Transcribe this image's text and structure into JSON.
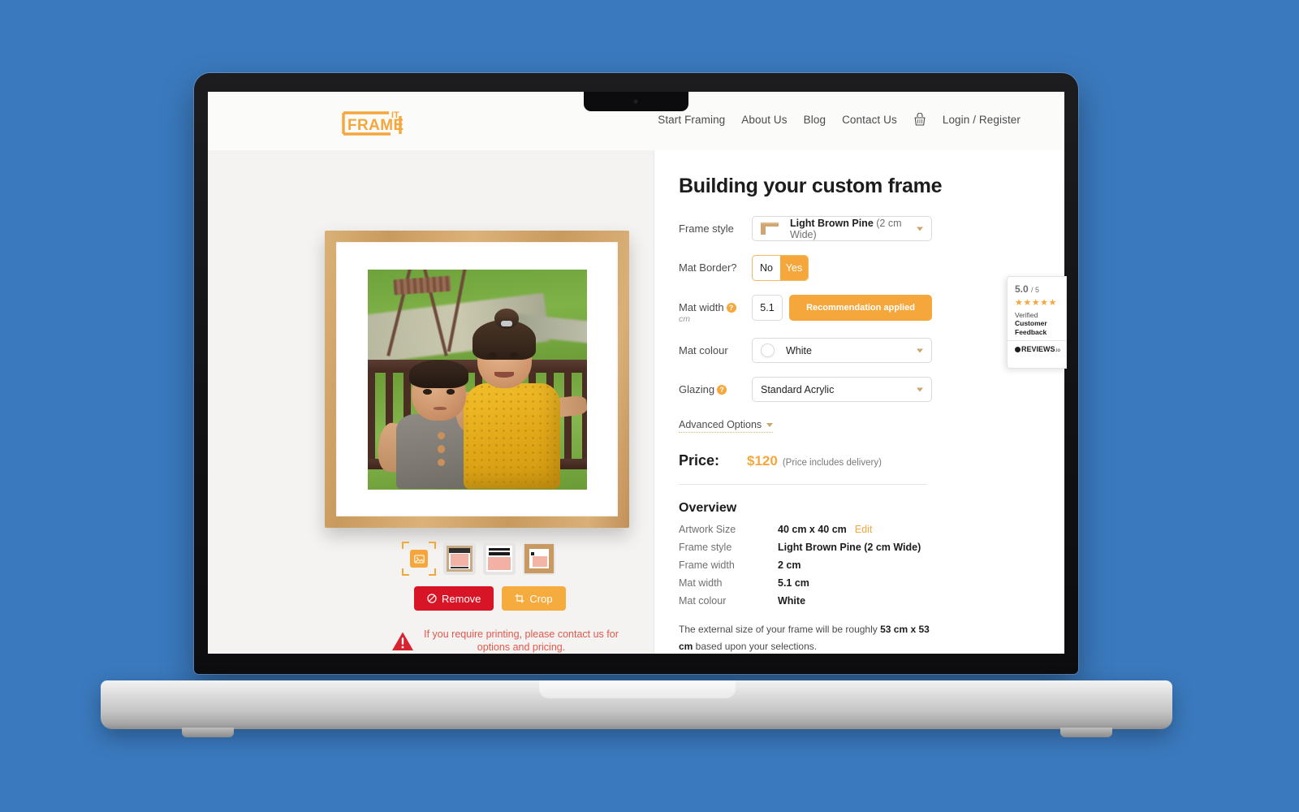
{
  "header": {
    "logo_text": "FRAME",
    "logo_sup": "IT",
    "nav": [
      {
        "label": "Start Framing"
      },
      {
        "label": "About Us"
      },
      {
        "label": "Blog"
      },
      {
        "label": "Contact Us"
      }
    ],
    "cart_icon": "shopping-basket-icon",
    "account_label": "Login / Register"
  },
  "preview": {
    "thumbnails": [
      {
        "name": "upload-artwork-thumbnail"
      },
      {
        "name": "artwork-thumbnail-2"
      },
      {
        "name": "artwork-thumbnail-3"
      },
      {
        "name": "artwork-thumbnail-4"
      }
    ],
    "remove_label": "Remove",
    "crop_label": "Crop",
    "warning_text": "If you require printing, please contact us for options and pricing."
  },
  "panel": {
    "title": "Building your custom frame",
    "frame_style": {
      "label": "Frame style",
      "value_bold": "Light Brown Pine",
      "value_muted": " (2 cm Wide)"
    },
    "mat_border": {
      "label": "Mat Border?",
      "option_no": "No",
      "option_yes": "Yes",
      "selected": "Yes"
    },
    "mat_width": {
      "label": "Mat width",
      "unit": "cm",
      "value": "5.1",
      "button_label": "Recommendation applied"
    },
    "mat_colour": {
      "label": "Mat colour",
      "value": "White"
    },
    "glazing": {
      "label": "Glazing",
      "value": "Standard Acrylic"
    },
    "advanced_options_label": "Advanced Options",
    "price": {
      "label": "Price:",
      "value": "$120",
      "note": "(Price includes delivery)"
    },
    "overview": {
      "title": "Overview",
      "rows": [
        {
          "key": "Artwork Size",
          "value": "40 cm x 40 cm",
          "edit": "Edit"
        },
        {
          "key": "Frame style",
          "value": "Light Brown Pine (2 cm Wide)"
        },
        {
          "key": "Frame width",
          "value": "2 cm"
        },
        {
          "key": "Mat width",
          "value": "5.1 cm"
        },
        {
          "key": "Mat colour",
          "value": "White"
        }
      ],
      "external_note_prefix": "The external size of your frame will be roughly ",
      "external_note_size": "53 cm x 53 cm",
      "external_note_suffix": " based upon your selections."
    }
  },
  "reviews_badge": {
    "score": "5.0",
    "out_of": "/ 5",
    "stars": "★★★★★",
    "verified": "Verified",
    "customer": "Customer",
    "feedback": "Feedback",
    "brand": "REVIEWS",
    "brand_suffix": ".io"
  },
  "colors": {
    "background": "#3a79bd",
    "accent": "#f5a73c",
    "danger": "#d81427",
    "warning_text": "#e2574c",
    "panel_bg": "#f4f3f1"
  }
}
